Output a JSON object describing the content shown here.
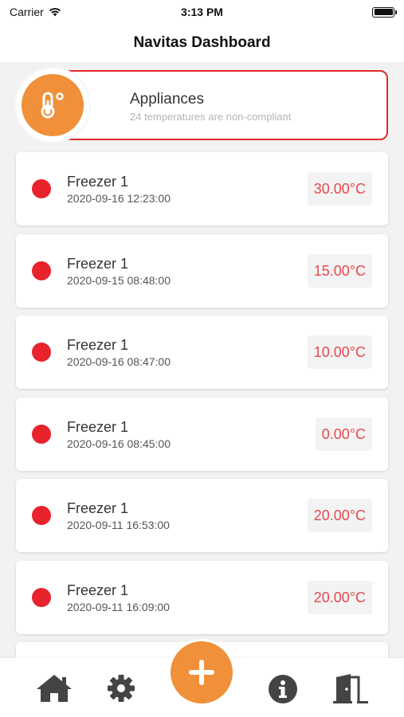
{
  "status_bar": {
    "carrier": "Carrier",
    "time": "3:13 PM"
  },
  "header": {
    "title": "Navitas Dashboard"
  },
  "summary": {
    "icon": "thermometer-icon",
    "title": "Appliances",
    "subtitle": "24 temperatures are non-compliant"
  },
  "readings": [
    {
      "name": "Freezer 1",
      "date": "2020-09-16 12:23:00",
      "temp": "30.00°C"
    },
    {
      "name": "Freezer 1",
      "date": "2020-09-15 08:48:00",
      "temp": "15.00°C"
    },
    {
      "name": "Freezer 1",
      "date": "2020-09-16 08:47:00",
      "temp": "10.00°C"
    },
    {
      "name": "Freezer 1",
      "date": "2020-09-16 08:45:00",
      "temp": "0.00°C"
    },
    {
      "name": "Freezer 1",
      "date": "2020-09-11 16:53:00",
      "temp": "20.00°C"
    },
    {
      "name": "Freezer 1",
      "date": "2020-09-11 16:09:00",
      "temp": "20.00°C"
    }
  ],
  "tab_bar": [
    "home-icon",
    "gear-icon",
    "add-icon",
    "info-icon",
    "logout-icon"
  ],
  "colors": {
    "accent": "#f0903a",
    "alert": "#e8232c",
    "temp_text": "#e8484e"
  }
}
